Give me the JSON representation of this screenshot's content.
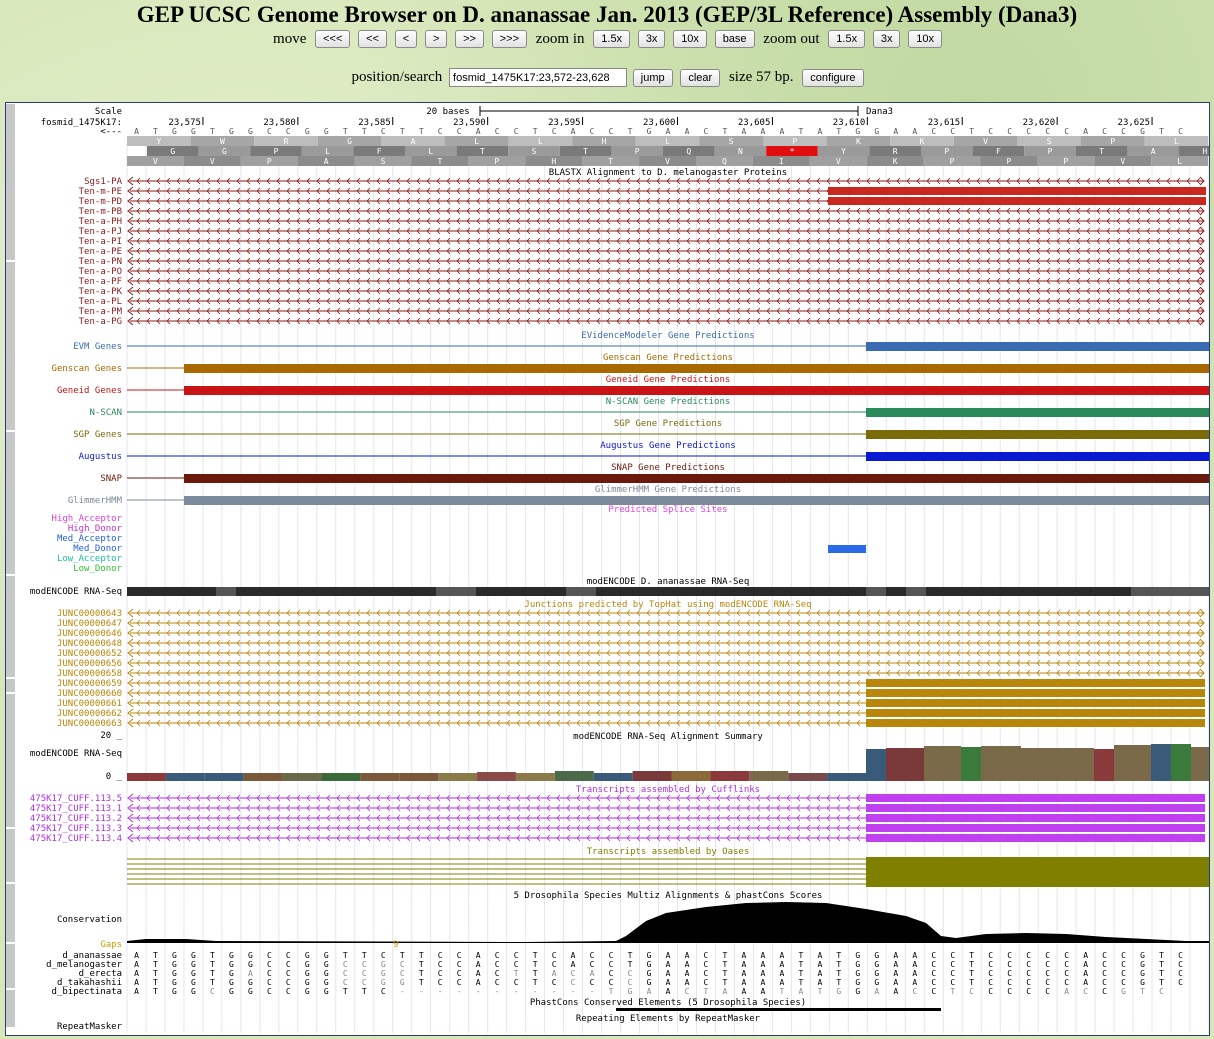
{
  "title": "GEP UCSC Genome Browser on D. ananassae Jan. 2013 (GEP/3L Reference) Assembly (Dana3)",
  "nav": {
    "move_label": "move",
    "move_buttons": [
      "<<<",
      "<<",
      "<",
      ">",
      ">>",
      ">>>"
    ],
    "zoom_in_label": "zoom in",
    "zoom_in_buttons": [
      "1.5x",
      "3x",
      "10x",
      "base"
    ],
    "zoom_out_label": "zoom out",
    "zoom_out_buttons": [
      "1.5x",
      "3x",
      "10x"
    ]
  },
  "search": {
    "label": "position/search",
    "value": "fosmid_1475K17:23,572-23,628",
    "jump": "jump",
    "clear": "clear",
    "size_text": "size 57 bp.",
    "configure": "configure"
  },
  "ruler": {
    "scale_label": "Scale",
    "scale_text": "20 bases",
    "assembly": "Dana3",
    "chrom_label": "fosmid_1475K17:",
    "ticks": [
      "23,575",
      "23,580",
      "23,585",
      "23,590",
      "23,595",
      "23,600",
      "23,605",
      "23,610",
      "23,615",
      "23,620",
      "23,625"
    ],
    "strand_label": "<---"
  },
  "sequence": "ATGGTGGCCGGTTCTTCCACCTCACCTGAACTAAATATGGAACCTCCCCCACCGTC",
  "amino_row1": "Y,W,R,G,A,L,L,H,L,S,P,K,K,V,S,P,L",
  "amino_row2": "G,G,P,L,F,L,T,S,T,P,Q,N,*,Y,R,P,F,P,T,A,H",
  "amino_row3": "V,V,P,A,S,T,P,H,T,V,Q,I,V,K,P,P,P,V,L",
  "tracks": {
    "blastx": {
      "title": "BLASTX Alignment to D. melanogaster Proteins",
      "items": [
        "Sgs1-PA",
        "Ten-m-PE",
        "Ten-m-PD",
        "Ten-m-PB",
        "Ten-a-PH",
        "Ten-a-PJ",
        "Ten-a-PI",
        "Ten-a-PE",
        "Ten-a-PN",
        "Ten-a-PO",
        "Ten-a-PF",
        "Ten-a-PK",
        "Ten-a-PL",
        "Ten-a-PM",
        "Ten-a-PG"
      ],
      "color": "#8b1a1a"
    },
    "gene_predictions": [
      {
        "label": "EVM Genes",
        "title": "EVidenceModeler Gene Predictions",
        "color": "#3a6ab0"
      },
      {
        "label": "Genscan Genes",
        "title": "Genscan Gene Predictions",
        "color": "#a86a00"
      },
      {
        "label": "Geneid Genes",
        "title": "Geneid Gene Predictions",
        "color": "#c81414"
      },
      {
        "label": "N-SCAN",
        "title": "N-SCAN Gene Predictions",
        "color": "#2a8a5a"
      },
      {
        "label": "SGP Genes",
        "title": "SGP Gene Predictions",
        "color": "#7a6a0a"
      },
      {
        "label": "Augustus",
        "title": "Augustus Gene Predictions",
        "color": "#0a1ad0"
      },
      {
        "label": "SNAP",
        "title": "SNAP Gene Predictions",
        "color": "#6a1a0a"
      },
      {
        "label": "GlimmerHMM",
        "title": "GlimmerHMM Gene Predictions",
        "color": "#7a8a9a"
      }
    ],
    "splice": {
      "title": "Predicted Splice Sites",
      "labels": [
        {
          "text": "High_Acceptor",
          "color": "#e040e0"
        },
        {
          "text": "High_Donor",
          "color": "#c030c0"
        },
        {
          "text": "Med_Acceptor",
          "color": "#2060e0"
        },
        {
          "text": "Med_Donor",
          "color": "#2060e0"
        },
        {
          "text": "Low_Acceptor",
          "color": "#20c0a0"
        },
        {
          "text": "Low_Donor",
          "color": "#30c030"
        }
      ]
    },
    "rnaseq": {
      "label": "modENCODE RNA-Seq",
      "title": "modENCODE D. ananassae RNA-Seq"
    },
    "junctions": {
      "title": "Junctions predicted by TopHat using modENCODE RNA-Seq",
      "items": [
        "JUNC00000643",
        "JUNC00000647",
        "JUNC00000646",
        "JUNC00000648",
        "JUNC00000652",
        "JUNC00000656",
        "JUNC00000658",
        "JUNC00000659",
        "JUNC00000660",
        "JUNC00000661",
        "JUNC00000662",
        "JUNC00000663"
      ],
      "color": "#b8860b"
    },
    "summary": {
      "label": "modENCODE RNA-Seq",
      "title": "modENCODE RNA-Seq Alignment Summary",
      "max": "20 _",
      "min": "0 _"
    },
    "cufflinks": {
      "title": "Transcripts assembled by Cufflinks",
      "items": [
        "475K17_CUFF.113.5",
        "475K17_CUFF.113.1",
        "475K17_CUFF.113.2",
        "475K17_CUFF.113.3",
        "475K17_CUFF.113.4"
      ],
      "color": "#b030e0"
    },
    "oases": {
      "title": "Transcripts assembled by Oases",
      "color": "#808000"
    },
    "conservation": {
      "title": "5 Drosophila Species Multiz Alignments & phastCons Scores",
      "label": "Conservation",
      "gaps_label": "Gaps",
      "gap_mark": "9",
      "species": [
        {
          "name": "d_ananassae",
          "seq": "ATGGTGGCCGGTTCTTCCACCTCACCTGAACTAAATATGGAACCTCCCCCACCGTC"
        },
        {
          "name": "d_melanogaster",
          "seq": "ATGGTGGCCGGCCGCTCCACCTCACCTGAACTAAATATGGAACCTCCCCCACCGTC"
        },
        {
          "name": "d_erecta",
          "seq": "ATGGTGACCGGCCGCTCCACTTACACCGAACTAAATATGGAACCTCCCCCACCGTC"
        },
        {
          "name": "d_takahashii",
          "seq": "ATGGTGGCCGGCCGGTCCACCTCCCCCGAACTAAATATGGAACCTCCCCCACCGTC"
        },
        {
          "name": "d_bipectinata",
          "seq": "ATGGCGGCCGGTTC-----------TGAACTAAATATGGAACCTCCCCCACCGTC"
        }
      ]
    },
    "phastcons": {
      "title": "PhastCons Conserved Elements (5 Drosophila Species)"
    },
    "repeatmasker": {
      "label": "RepeatMasker",
      "title": "Repeating Elements by RepeatMasker"
    }
  }
}
